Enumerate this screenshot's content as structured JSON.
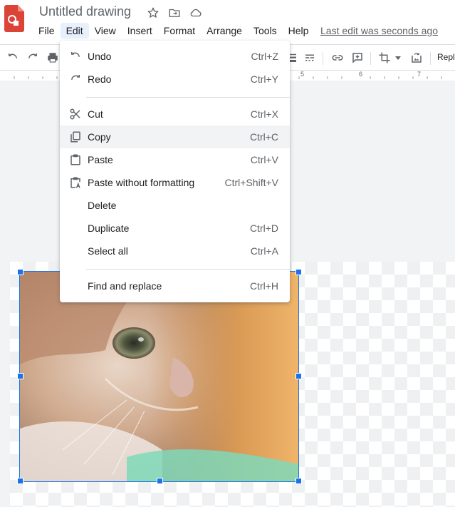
{
  "app": {
    "title": "Untitled drawing",
    "last_edit": "Last edit was seconds ago",
    "title_icons": [
      "star-icon",
      "move-to-folder-icon",
      "cloud-saved-icon"
    ]
  },
  "menubar": {
    "items": [
      "File",
      "Edit",
      "View",
      "Insert",
      "Format",
      "Arrange",
      "Tools",
      "Help"
    ],
    "active": "Edit"
  },
  "toolbar": {
    "icons": [
      "undo-icon",
      "redo-icon",
      "print-icon",
      "line-dash-icon",
      "line-weight-icon",
      "link-icon",
      "comment-icon",
      "crop-icon",
      "crop-dropdown-icon",
      "replace-image-icon"
    ],
    "replace_label": "Repl"
  },
  "ruler": {
    "labels": [
      "5",
      "6",
      "7"
    ]
  },
  "edit_menu": {
    "items": [
      {
        "label": "Undo",
        "shortcut": "Ctrl+Z",
        "icon": "undo-icon"
      },
      {
        "label": "Redo",
        "shortcut": "Ctrl+Y",
        "icon": "redo-icon"
      },
      {
        "label": "Cut",
        "shortcut": "Ctrl+X",
        "icon": "scissors-icon"
      },
      {
        "label": "Copy",
        "shortcut": "Ctrl+C",
        "icon": "copy-icon"
      },
      {
        "label": "Paste",
        "shortcut": "Ctrl+V",
        "icon": "clipboard-icon"
      },
      {
        "label": "Paste without formatting",
        "shortcut": "Ctrl+Shift+V",
        "icon": "paste-plain-icon"
      },
      {
        "label": "Delete",
        "shortcut": "",
        "icon": ""
      },
      {
        "label": "Duplicate",
        "shortcut": "Ctrl+D",
        "icon": ""
      },
      {
        "label": "Select all",
        "shortcut": "Ctrl+A",
        "icon": ""
      },
      {
        "label": "Find and replace",
        "shortcut": "Ctrl+H",
        "icon": ""
      }
    ],
    "highlighted": "Copy"
  },
  "canvas": {
    "image_description_icon": "cat-photo"
  },
  "colors": {
    "accent": "#1a73e8",
    "app_red": "#db4437",
    "menu_hover": "#f1f3f4",
    "active_menu_bg": "#e8f0fe"
  }
}
